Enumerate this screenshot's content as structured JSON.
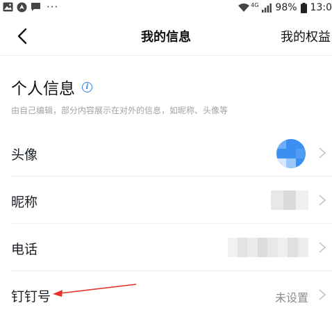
{
  "status_bar": {
    "battery": "98%",
    "time": "13:0",
    "network": "4G"
  },
  "nav": {
    "title": "我的信息",
    "right_action": "我的权益"
  },
  "section": {
    "title": "个人信息",
    "description": "由自己编辑，部分内容展示在对外的信息，如昵称、头像等"
  },
  "rows": [
    {
      "label": "头像",
      "value": ""
    },
    {
      "label": "昵称",
      "value": ""
    },
    {
      "label": "电话",
      "value": ""
    },
    {
      "label": "钉钉号",
      "value": "未设置"
    }
  ],
  "colors": {
    "accent": "#2a7ef2",
    "annotation_arrow": "#e8302a",
    "divider": "#ececec",
    "muted_text": "#a0a3a7"
  }
}
